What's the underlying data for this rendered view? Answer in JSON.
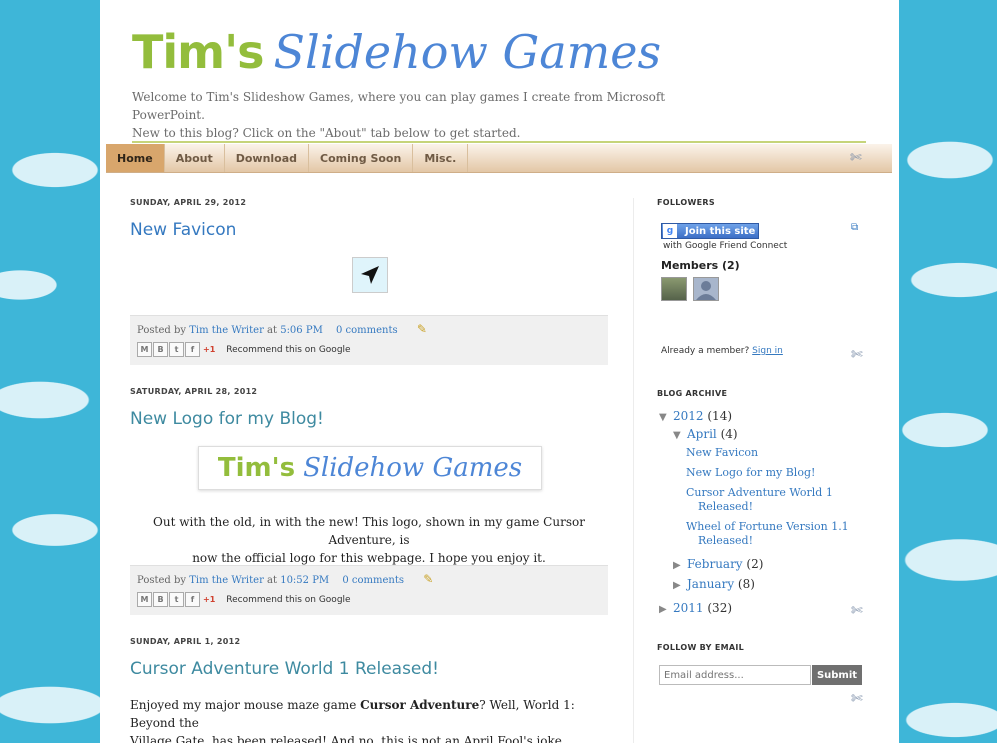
{
  "blog": {
    "title_part1": "Tim's",
    "title_part2": "Slidehow Games",
    "description_line1": "Welcome to Tim's Slideshow Games, where you can play games I create from Microsoft PowerPoint.",
    "description_line2": "New to this blog? Click on the \"About\" tab below to get started."
  },
  "tabs": [
    {
      "label": "Home",
      "active": true
    },
    {
      "label": "About"
    },
    {
      "label": "Download"
    },
    {
      "label": "Coming Soon"
    },
    {
      "label": "Misc."
    }
  ],
  "posts": [
    {
      "date": "SUNDAY, APRIL 29, 2012",
      "title": "New Favicon",
      "posted_by": "Posted by",
      "author": "Tim the Writer",
      "at": "at",
      "time": "5:06 PM",
      "comments": "0 comments"
    },
    {
      "date": "SATURDAY, APRIL 28, 2012",
      "title": "New Logo for my Blog!",
      "image_text_part1": "Tim's",
      "image_text_part2": "Slidehow Games",
      "body_line1": "Out with the old, in with the new! This logo, shown in my game Cursor Adventure, is",
      "body_line2": "now the official logo for this webpage. I hope you enjoy it.",
      "posted_by": "Posted by",
      "author": "Tim the Writer",
      "at": "at",
      "time": "10:52 PM",
      "comments": "0 comments"
    },
    {
      "date": "SUNDAY, APRIL 1, 2012",
      "title": "Cursor Adventure World 1 Released!",
      "body_pre": "Enjoyed my major mouse maze game ",
      "body_bold": "Cursor Adventure",
      "body_post": "? Well, World 1: Beyond the",
      "body_line2": "Village Gate, has been released! And no, this is not an April Fool's joke."
    }
  ],
  "share": {
    "buttons": [
      "M",
      "B",
      "t",
      "f"
    ],
    "plus_one": "+1",
    "recommend": "Recommend this on Google"
  },
  "sidebar": {
    "followers_title": "FOLLOWERS",
    "join_label": "Join this site",
    "gfc_text": "with Google Friend Connect",
    "members_label": "Members (2)",
    "already_member": "Already a member?",
    "sign_in": "Sign in",
    "archive_title": "BLOG ARCHIVE",
    "archive": {
      "y2012": "2012",
      "y2012_count": "(14)",
      "april": "April",
      "april_count": "(4)",
      "april_posts": [
        "New Favicon",
        "New Logo for my Blog!",
        "Cursor Adventure World 1",
        "Released!",
        "Wheel of Fortune Version 1.1",
        "Released!"
      ],
      "february": "February",
      "february_count": "(2)",
      "january": "January",
      "january_count": "(8)",
      "y2011": "2011",
      "y2011_count": "(32)"
    },
    "follow_email_title": "FOLLOW BY EMAIL",
    "email_placeholder": "Email address...",
    "submit_label": "Submit"
  },
  "colors": {
    "background": "#3eb6d8",
    "logo_green": "#93bd3c",
    "logo_blue": "#4d86d6",
    "link": "#3579c0",
    "active_tab": "#d8a66c"
  }
}
